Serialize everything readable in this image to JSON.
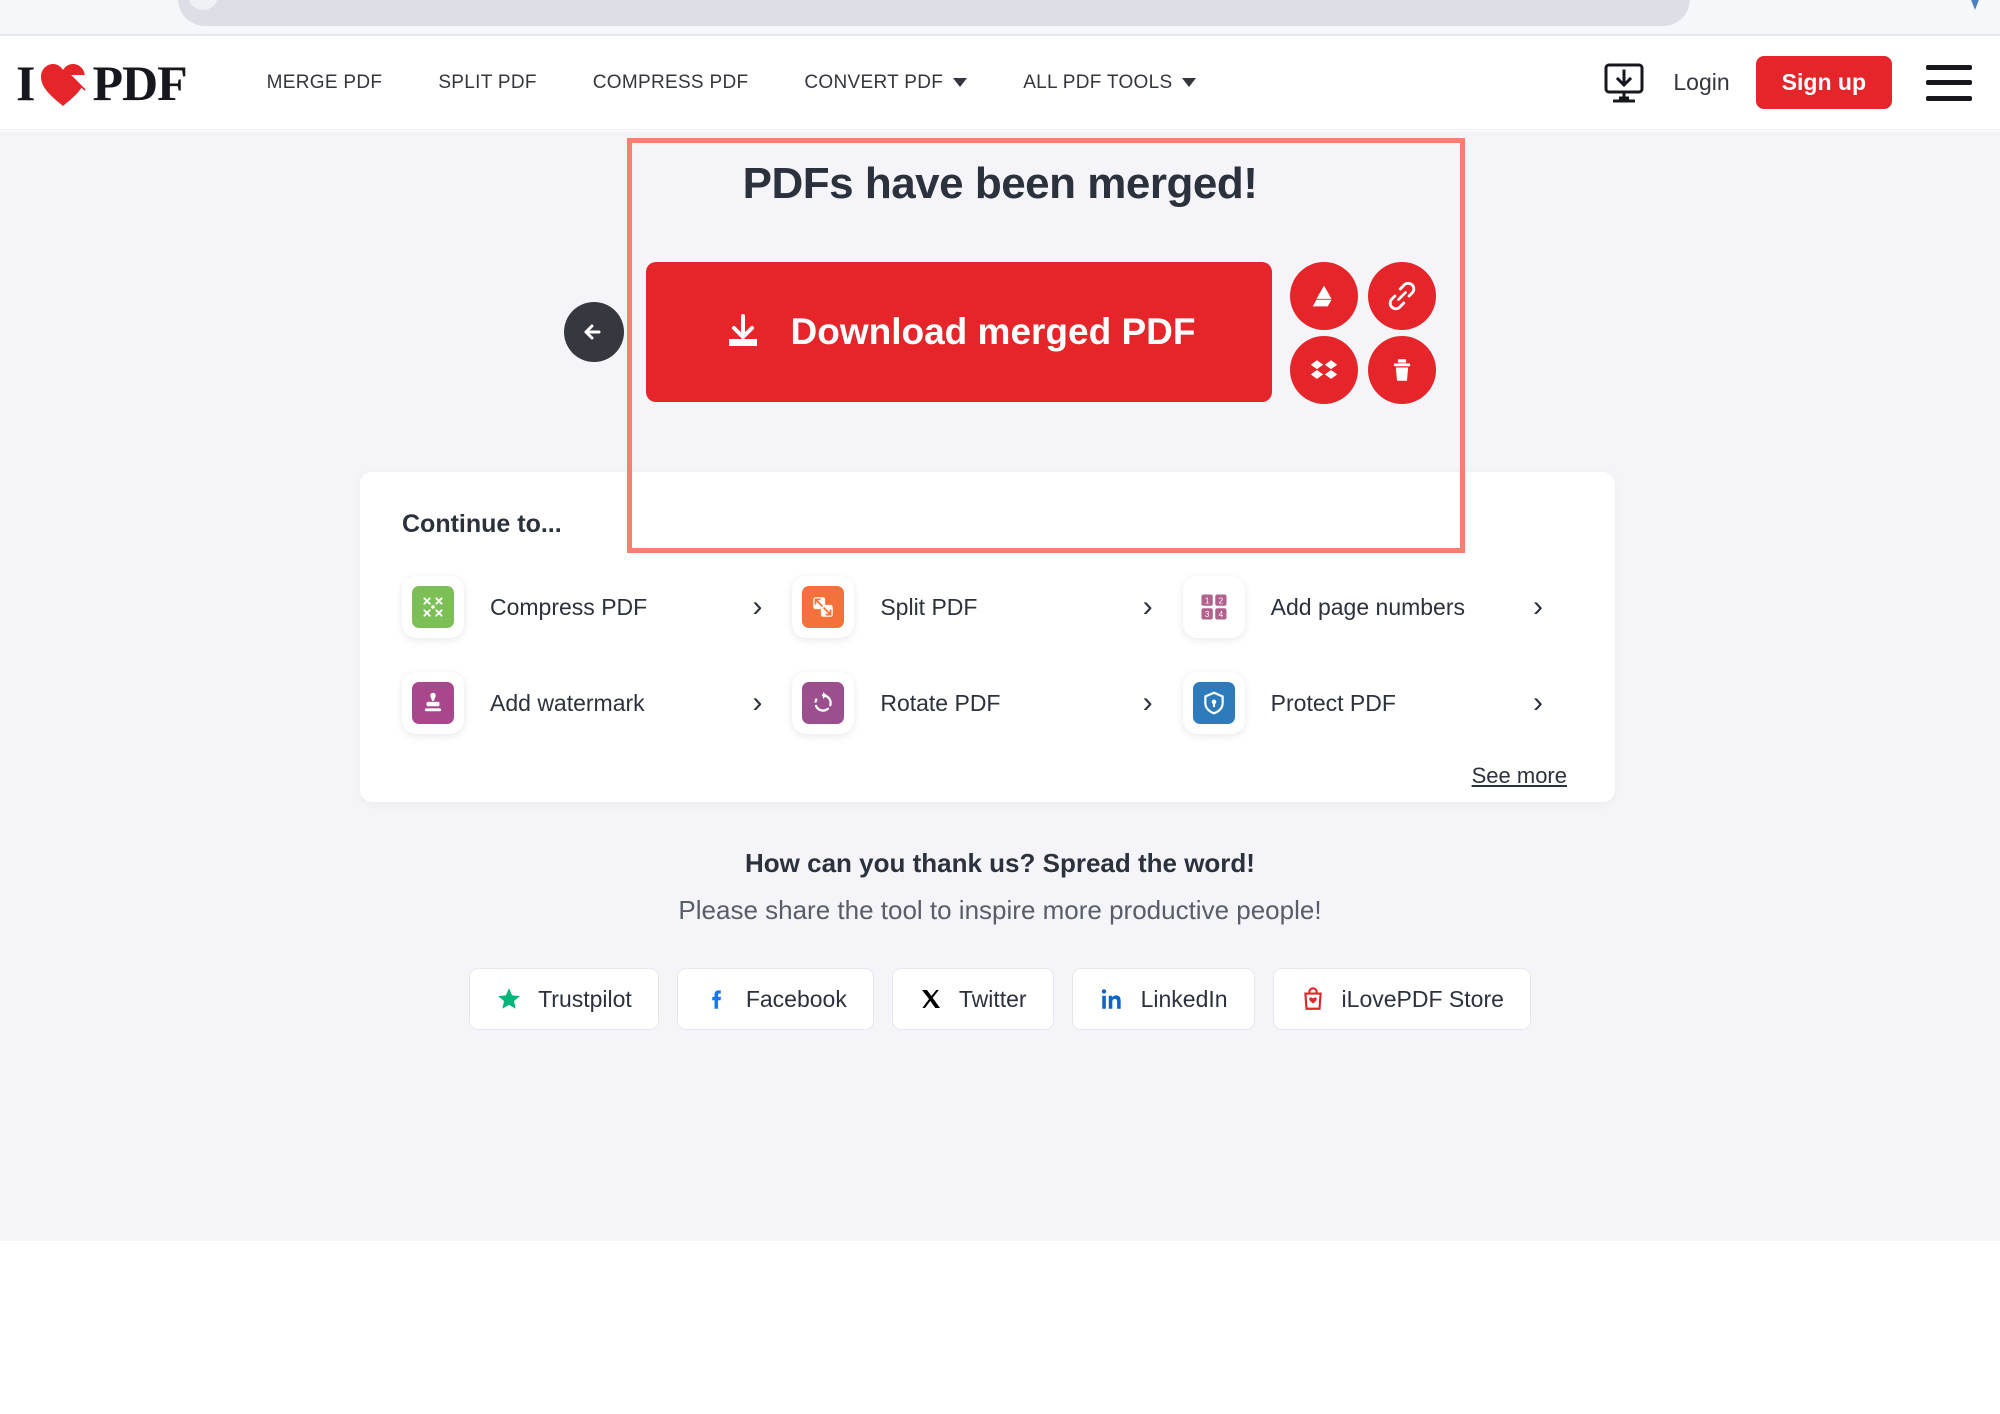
{
  "brand": {
    "logo_i": "I",
    "logo_pdf": "PDF",
    "accent_red": "#e5252a",
    "highlight_border": "#f4806f"
  },
  "header": {
    "nav": [
      {
        "label": "MERGE PDF",
        "has_caret": false
      },
      {
        "label": "SPLIT PDF",
        "has_caret": false
      },
      {
        "label": "COMPRESS PDF",
        "has_caret": false
      },
      {
        "label": "CONVERT PDF",
        "has_caret": true
      },
      {
        "label": "ALL PDF TOOLS",
        "has_caret": true
      }
    ],
    "desktop_icon": "desktop-download-icon",
    "login_label": "Login",
    "signup_label": "Sign up",
    "menu_icon": "hamburger-menu-icon"
  },
  "result": {
    "title": "PDFs have been merged!",
    "download_label": "Download merged PDF",
    "download_icon": "download-icon",
    "back_icon": "arrow-left-icon",
    "actions": [
      {
        "name": "google-drive",
        "icon": "google-drive-icon"
      },
      {
        "name": "copy-link",
        "icon": "link-icon"
      },
      {
        "name": "dropbox",
        "icon": "dropbox-icon"
      },
      {
        "name": "delete",
        "icon": "trash-icon"
      }
    ]
  },
  "continue": {
    "title": "Continue to...",
    "see_more": "See more",
    "tools": [
      {
        "label": "Compress PDF",
        "icon": "compress-icon",
        "color": "#7dbf57",
        "chevron": "›"
      },
      {
        "label": "Split PDF",
        "icon": "split-icon",
        "color": "#f4713c",
        "chevron": "›"
      },
      {
        "label": "Add page numbers",
        "icon": "page-numbers-icon",
        "color": "#b0628c",
        "chevron": "›"
      },
      {
        "label": "Add watermark",
        "icon": "watermark-icon",
        "color": "#a8478c",
        "chevron": "›"
      },
      {
        "label": "Rotate PDF",
        "icon": "rotate-icon",
        "color": "#9c4f8e",
        "chevron": "›"
      },
      {
        "label": "Protect PDF",
        "icon": "protect-icon",
        "color": "#2d7bbd",
        "chevron": "›"
      }
    ]
  },
  "thanks": {
    "title": "How can you thank us? Spread the word!",
    "subtitle": "Please share the tool to inspire more productive people!",
    "share_buttons": [
      {
        "label": "Trustpilot",
        "icon": "trustpilot-star-icon",
        "color": "#00b67a"
      },
      {
        "label": "Facebook",
        "icon": "facebook-icon",
        "color": "#1877f2"
      },
      {
        "label": "Twitter",
        "icon": "twitter-x-icon",
        "color": "#000000"
      },
      {
        "label": "LinkedIn",
        "icon": "linkedin-icon",
        "color": "#0a66c2"
      },
      {
        "label": "iLovePDF Store",
        "icon": "store-bag-icon",
        "color": "#e5252a"
      }
    ]
  }
}
